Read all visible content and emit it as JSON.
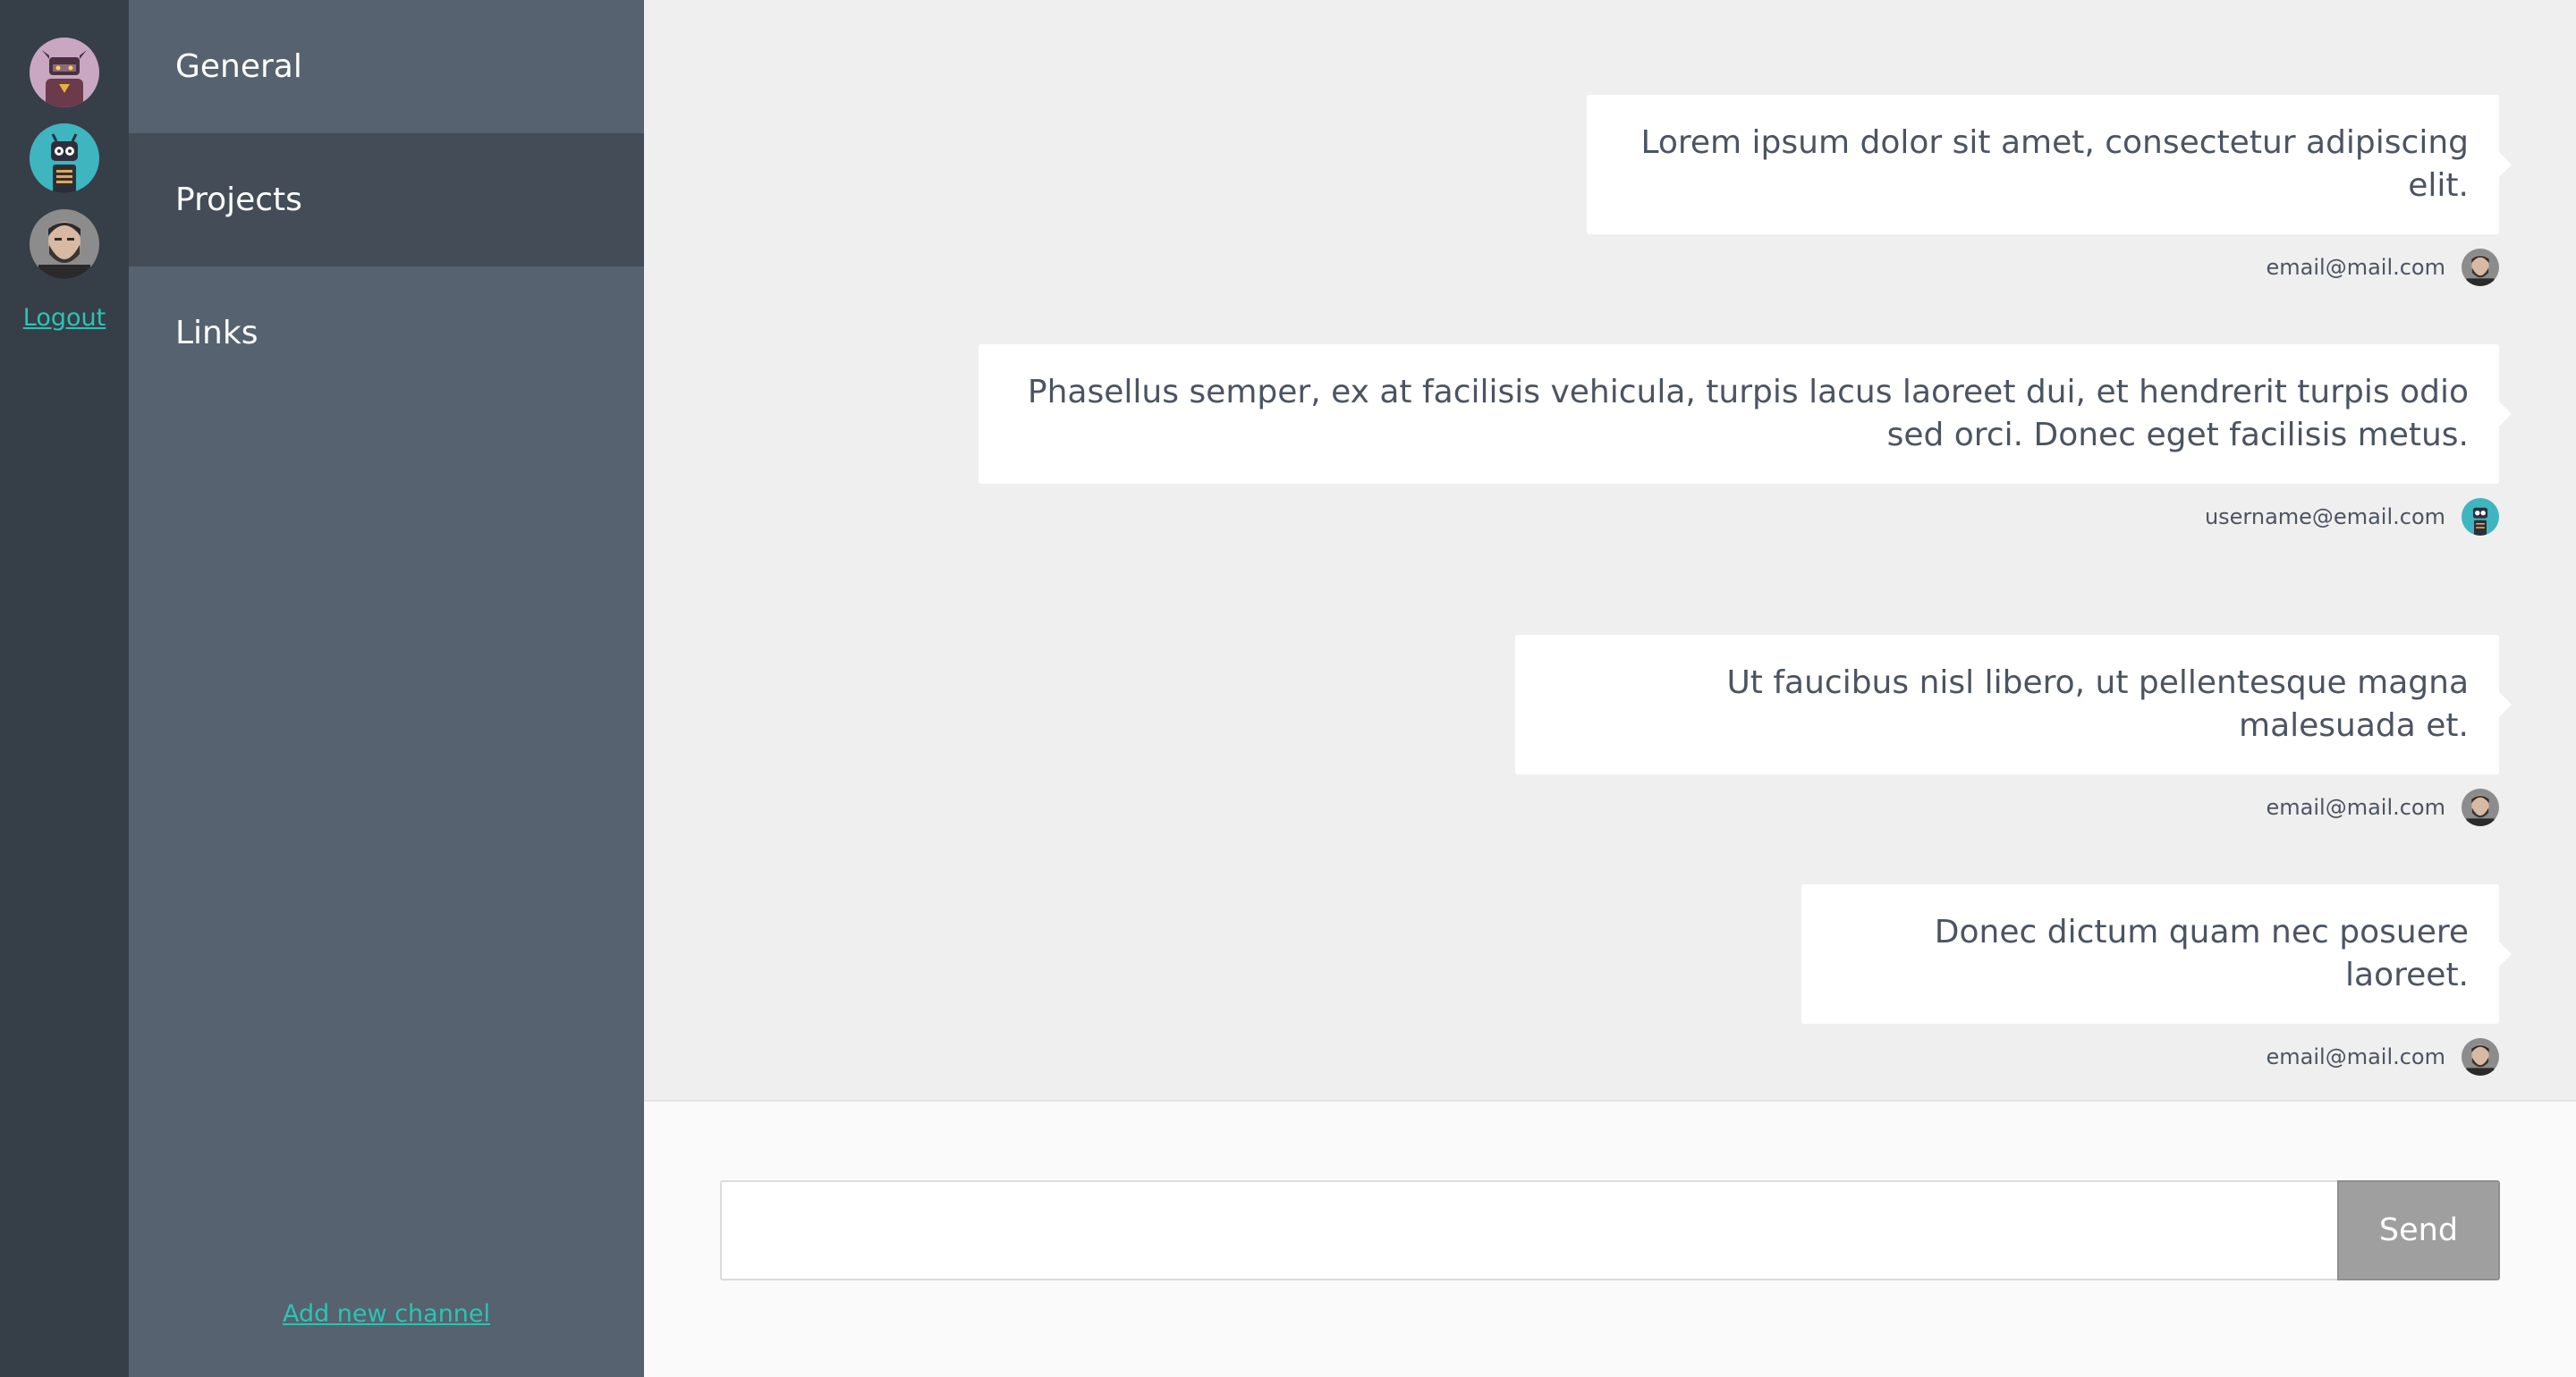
{
  "sidebar": {
    "avatars": [
      {
        "name": "robot-viking-avatar",
        "bg": "#c9a7c2"
      },
      {
        "name": "robot-teal-avatar",
        "bg": "#3fb5c0"
      },
      {
        "name": "bearded-man-avatar",
        "bg": "#7a7a7a"
      }
    ],
    "logout_label": "Logout"
  },
  "channels": {
    "items": [
      {
        "label": "General",
        "active": false
      },
      {
        "label": "Projects",
        "active": true
      },
      {
        "label": "Links",
        "active": false
      }
    ],
    "add_label": "Add new channel"
  },
  "messages": [
    {
      "text": "Lorem ipsum dolor sit amet, consectetur adipiscing elit.",
      "author": "email@mail.com",
      "avatar": "bearded-man-avatar"
    },
    {
      "text": "Phasellus semper, ex at facilisis vehicula, turpis lacus laoreet dui, et hendrerit turpis odio sed orci. Donec eget facilisis metus.",
      "author": "username@email.com",
      "avatar": "robot-teal-avatar"
    },
    {
      "text": "Ut faucibus nisl libero, ut pellentesque magna malesuada et.",
      "author": "email@mail.com",
      "avatar": "bearded-man-avatar"
    },
    {
      "text": "Donec dictum quam nec posuere laoreet.",
      "author": "email@mail.com",
      "avatar": "bearded-man-avatar"
    }
  ],
  "composer": {
    "input_value": "",
    "send_label": "Send"
  },
  "colors": {
    "accent": "#2bc4b4",
    "rail": "#363e48",
    "channels_bg": "#56626f",
    "channel_active": "#434c57",
    "send_bg": "#9f9f9f"
  }
}
